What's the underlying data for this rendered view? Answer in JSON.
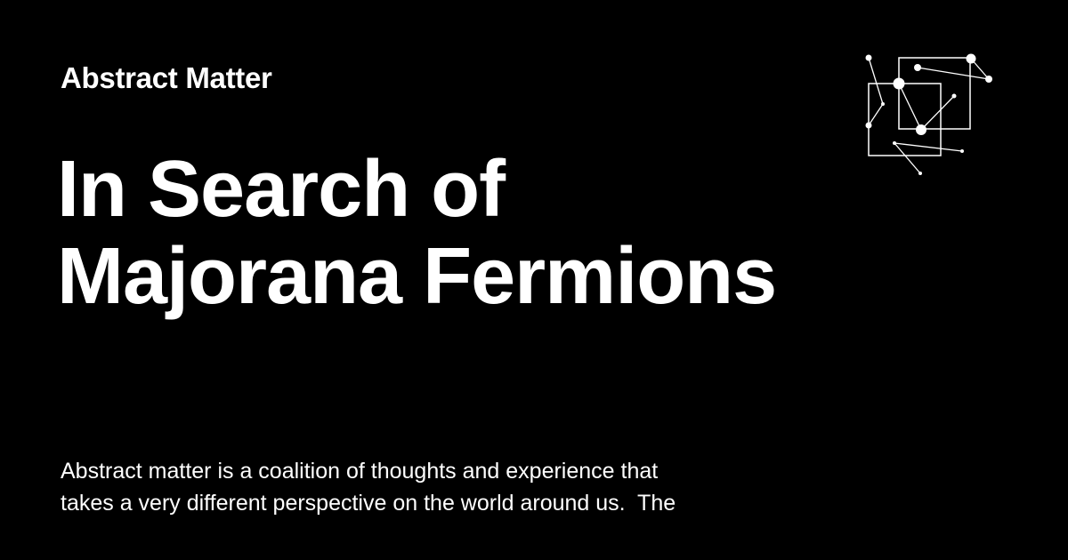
{
  "brand": {
    "name": "Abstract Matter",
    "logo_icon": "network-squares-icon",
    "color": "#ffffff"
  },
  "headline": {
    "line1": "In Search of",
    "line2": "Majorana Fermions"
  },
  "description": {
    "line1": "Abstract matter is a coalition of thoughts and experience that",
    "line2": "takes a very different perspective on the world around us.  The"
  },
  "theme": {
    "background": "#000000",
    "text": "#ffffff"
  }
}
